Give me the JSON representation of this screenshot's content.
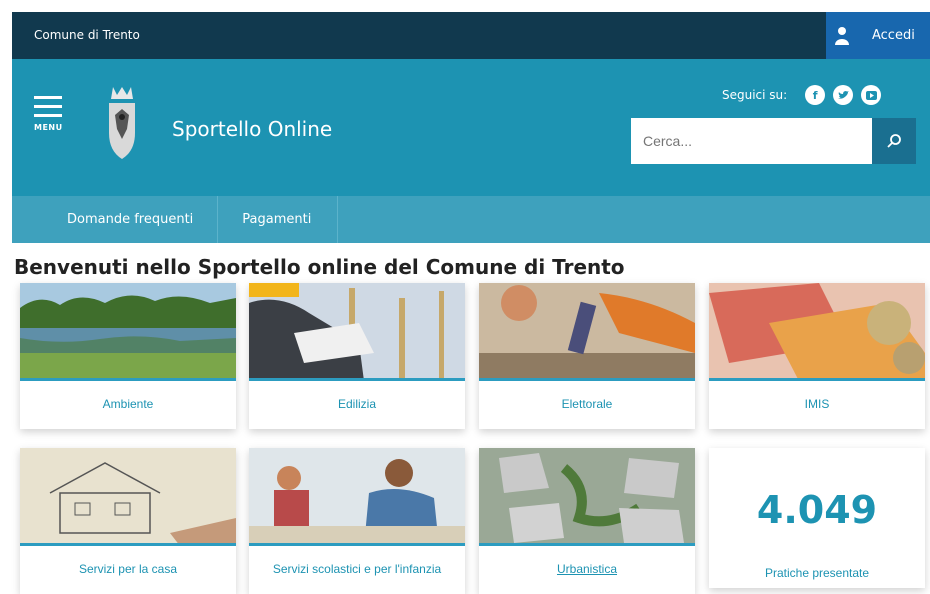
{
  "topbar": {
    "site": "Comune di Trento",
    "login_label": "Accedi"
  },
  "header": {
    "menu_label": "MENU",
    "brand": "Sportello Online",
    "social_label": "Seguici su:",
    "search_placeholder": "Cerca..."
  },
  "nav": {
    "items": [
      "Domande frequenti",
      "Pagamenti"
    ]
  },
  "main": {
    "title": "Benvenuti nello Sportello online del Comune di Trento",
    "cards": [
      "Ambiente",
      "Edilizia",
      "Elettorale",
      "IMIS",
      "Servizi per la casa",
      "Servizi scolastici e per l'infanzia",
      "Urbanistica"
    ],
    "counter": {
      "value": "4.049",
      "label": "Pratiche presentate"
    }
  },
  "colors": {
    "topbar": "#11394e",
    "header": "#1d93b2",
    "nav": "#3ea1bd",
    "login": "#1867ae"
  }
}
